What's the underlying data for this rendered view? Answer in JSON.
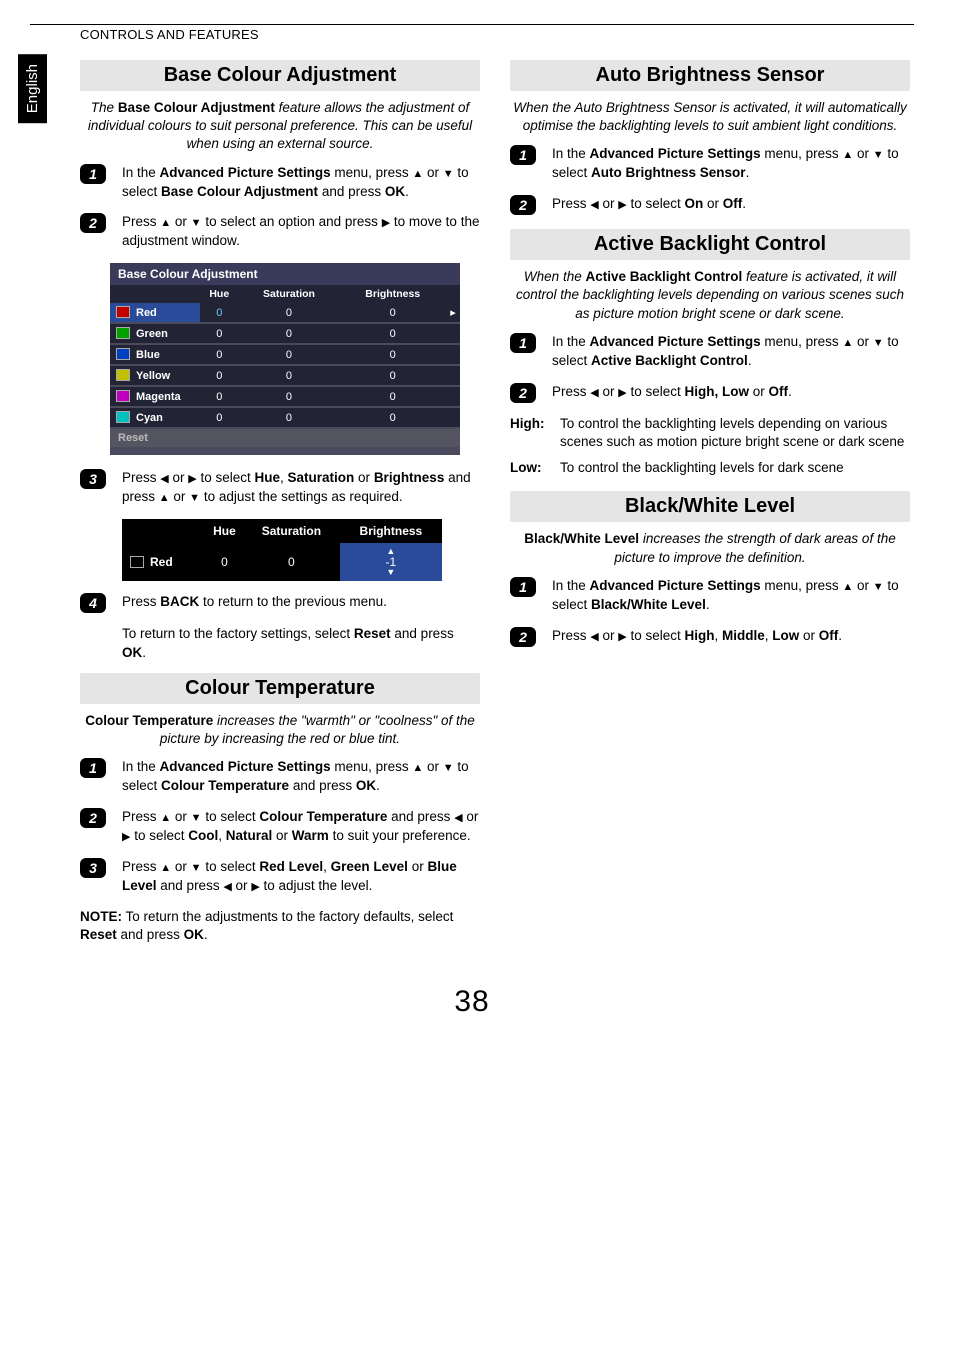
{
  "header": {
    "section": "CONTROLS AND FEATURES",
    "lang_tab": "English"
  },
  "glyph": {
    "up": "▲",
    "down": "▼",
    "left": "◀",
    "right": "▶"
  },
  "left": {
    "bca": {
      "title": "Base Colour Adjustment",
      "intro_pre": "The ",
      "intro_bold": "Base Colour Adjustment",
      "intro_post": " feature allows the adjustment of individual colours to suit personal preference. This can be useful when using an external source.",
      "step1_a": "In the ",
      "step1_b": "Advanced Picture Settings",
      "step1_c": " menu, press ",
      "step1_d": " or ",
      "step1_e": " to select ",
      "step1_f": "Base Colour Adjustment",
      "step1_g": " and press ",
      "step1_h": "OK",
      "step1_i": ".",
      "step2_a": "Press ",
      "step2_b": " or ",
      "step2_c": " to select an option and press ",
      "step2_d": " to move to the adjustment window.",
      "table": {
        "title": "Base Colour Adjustment",
        "cols": [
          "",
          "Hue",
          "Saturation",
          "Brightness"
        ],
        "rows": [
          {
            "label": "Red",
            "sw": "#c00000",
            "vals": [
              "0",
              "0",
              "0"
            ],
            "selected": true
          },
          {
            "label": "Green",
            "sw": "#00a000",
            "vals": [
              "0",
              "0",
              "0"
            ],
            "selected": false
          },
          {
            "label": "Blue",
            "sw": "#0040c0",
            "vals": [
              "0",
              "0",
              "0"
            ],
            "selected": false
          },
          {
            "label": "Yellow",
            "sw": "#c0c000",
            "vals": [
              "0",
              "0",
              "0"
            ],
            "selected": false
          },
          {
            "label": "Magenta",
            "sw": "#c000c0",
            "vals": [
              "0",
              "0",
              "0"
            ],
            "selected": false
          },
          {
            "label": "Cyan",
            "sw": "#00c0c0",
            "vals": [
              "0",
              "0",
              "0"
            ],
            "selected": false
          }
        ],
        "reset": "Reset"
      },
      "step3_a": "Press ",
      "step3_b": " or ",
      "step3_c": " to select ",
      "step3_d": "Hue",
      "step3_e": ", ",
      "step3_f": "Saturation",
      "step3_g": " or ",
      "step3_h": "Brightness",
      "step3_i": " and press ",
      "step3_j": " or ",
      "step3_k": " to adjust the settings as required.",
      "table2": {
        "cols": [
          "",
          "Hue",
          "Saturation",
          "Brightness"
        ],
        "row": {
          "label": "Red",
          "vals": [
            "0",
            "0",
            "-1"
          ]
        }
      },
      "step4_a": "Press ",
      "step4_b": "BACK",
      "step4_c": " to return to the previous menu.",
      "step_reset_a": "To return to the factory settings, select ",
      "step_reset_b": "Reset",
      "step_reset_c": " and press ",
      "step_reset_d": "OK",
      "step_reset_e": "."
    },
    "ct": {
      "title": "Colour Temperature",
      "intro_bold": "Colour Temperature",
      "intro_post": " increases the \"warmth\" or \"coolness\" of the picture by increasing the red or blue tint.",
      "step1_a": "In the ",
      "step1_b": "Advanced Picture Settings",
      "step1_c": " menu, press ",
      "step1_d": " or ",
      "step1_e": " to select ",
      "step1_f": "Colour Temperature",
      "step1_g": " and press ",
      "step1_h": "OK",
      "step1_i": ".",
      "step2_a": "Press ",
      "step2_b": " or ",
      "step2_c": " to select ",
      "step2_d": "Colour Temperature",
      "step2_e": " and press ",
      "step2_f": " or ",
      "step2_g": " to select ",
      "step2_h": "Cool",
      "step2_i": ", ",
      "step2_j": "Natural",
      "step2_k": " or ",
      "step2_l": "Warm",
      "step2_m": " to suit your preference.",
      "step3_a": "Press ",
      "step3_b": " or ",
      "step3_c": " to select ",
      "step3_d": "Red Level",
      "step3_e": ", ",
      "step3_f": "Green Level",
      "step3_g": " or ",
      "step3_h": "Blue Level",
      "step3_i": " and press ",
      "step3_j": " or ",
      "step3_k": " to adjust the level.",
      "note_a": "NOTE:",
      "note_b": " To return the adjustments to the factory defaults, select ",
      "note_c": "Reset",
      "note_d": " and press ",
      "note_e": "OK",
      "note_f": "."
    }
  },
  "right": {
    "abs": {
      "title": "Auto Brightness Sensor",
      "intro": "When the Auto Brightness Sensor is activated, it will automatically optimise the backlighting levels to suit ambient light conditions.",
      "step1_a": "In the ",
      "step1_b": "Advanced Picture Settings",
      "step1_c": " menu, press ",
      "step1_d": " or ",
      "step1_e": " to select ",
      "step1_f": "Auto Brightness Sensor",
      "step1_g": ".",
      "step2_a": "Press ",
      "step2_b": " or ",
      "step2_c": " to select ",
      "step2_d": "On",
      "step2_e": " or ",
      "step2_f": "Off",
      "step2_g": "."
    },
    "abc": {
      "title": "Active Backlight Control",
      "intro_a": "When the ",
      "intro_b": "Active Backlight Control",
      "intro_c": " feature is activated, it will control the backlighting levels depending on various scenes such as picture motion bright scene or dark scene.",
      "step1_a": "In the ",
      "step1_b": "Advanced Picture Settings",
      "step1_c": " menu, press ",
      "step1_d": " or ",
      "step1_e": " to select ",
      "step1_f": "Active Backlight Control",
      "step1_g": ".",
      "step2_a": "Press ",
      "step2_b": " or ",
      "step2_c": " to select ",
      "step2_d": "High, Low",
      "step2_e": " or ",
      "step2_f": "Off",
      "step2_g": ".",
      "high_k": "High:",
      "high_v": "To control the backlighting levels depending on various scenes such as motion picture bright scene or dark scene",
      "low_k": "Low:",
      "low_v": "To control the backlighting levels for dark scene"
    },
    "bwl": {
      "title": "Black/White Level",
      "intro_b": "Black/White Level",
      "intro_c": " increases the strength of dark areas of the picture to improve the definition.",
      "step1_a": "In the ",
      "step1_b": "Advanced Picture Settings",
      "step1_c": " menu, press ",
      "step1_d": " or ",
      "step1_e": " to select ",
      "step1_f": "Black/White Level",
      "step1_g": ".",
      "step2_a": "Press ",
      "step2_b": " or ",
      "step2_c": " to select ",
      "step2_d": "High",
      "step2_e": ", ",
      "step2_f": "Middle",
      "step2_g": ", ",
      "step2_h": "Low",
      "step2_i": " or ",
      "step2_j": "Off",
      "step2_k": "."
    }
  },
  "page_number": "38"
}
